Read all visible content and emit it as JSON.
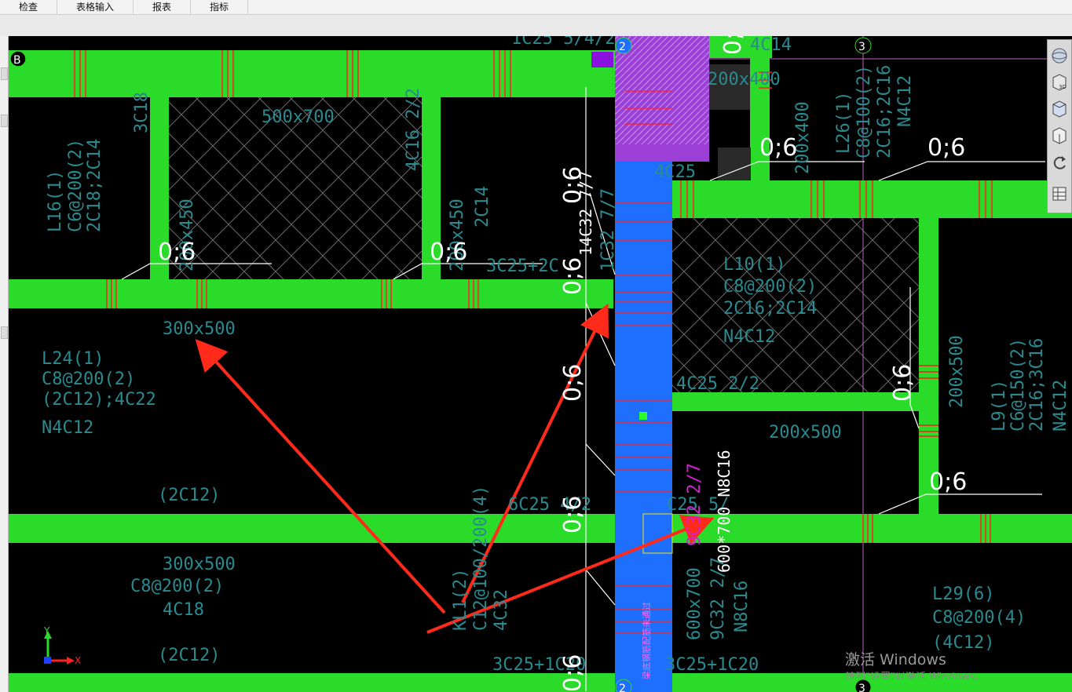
{
  "menu": {
    "items": [
      {
        "label": "检查"
      },
      {
        "label": "表格输入"
      },
      {
        "label": "报表"
      },
      {
        "label": "指标"
      }
    ]
  },
  "axes": {
    "grid_b": "B",
    "grid_2_top": "2",
    "grid_3_top": "3",
    "grid_2_bottom": "2",
    "grid_3_bottom": "3",
    "y_label": "Y",
    "x_label": "X"
  },
  "labels": {
    "sec_500x700": "500x700",
    "tag_4c16": "4C16 2/2",
    "tag_3c18": "3C18",
    "beam_l16": "L16(1)",
    "beam_l16_stirrup": "C6@200(2)",
    "beam_l16_bars": "2C18;2C14",
    "sec_200x450_a": "200x450",
    "sec_200x450_b": "200x450",
    "tag_2c14": "2C14",
    "tag_3c25_2c": "3C25+2C",
    "tag_top_1c25": "1C25 5/4/2",
    "sec_200x400_a": "200x400",
    "sec_200x400_b": "200x400",
    "tag_4c14": "4C14",
    "beam_l26": "L26(1)",
    "beam_l26_stirrup": "C8@100(2)",
    "beam_l26_bars": "2C16;2C16",
    "beam_l26_n": "N4C12",
    "tag_4c25": "4C25",
    "beam_l10": "L10(1)",
    "beam_l10_stirrup": "C8@200(2)",
    "beam_l10_bars": "2C16;2C14",
    "beam_l10_n": "N4C12",
    "tag_4c25_22": "4C25 2/2",
    "sec_200x500_h": "200x500",
    "sec_200x500_v": "200x500",
    "beam_l9": "L9(1)",
    "beam_l9_stirrup": "C6@150(2)",
    "beam_l9_bars": "2C16;3C16",
    "beam_l9_n": "N4C12",
    "sec_300x500_a": "300x500",
    "beam_l24": "L24(1)",
    "beam_l24_stirrup": "C8@200(2)",
    "beam_l24_bars": "(2C12);4C22",
    "beam_l24_n": "N4C12",
    "tag_2c12_a": "(2C12)",
    "tag_6c25_4": "6C25 4/2",
    "tag_c25_5": "C25 5/",
    "sec_300x500_b": "300x500",
    "stirrup_c8_b": "C8@200(2)",
    "tag_4c18": "4C18",
    "tag_2c12_b": "(2C12)",
    "beam_kl1": "KL1(2)",
    "beam_kl1_stirrup": "C12@100/200(4)",
    "beam_kl1_bars": "4C32",
    "tag_3c25_1c20_a": "3C25+1C20",
    "tag_3c25_1c20_b": "3C25+1C20",
    "sec_600x700": "600x700",
    "tag_9c32": "9C32 2/7",
    "tag_n8c16": "N8C16",
    "beam_l29": "L29(6)",
    "beam_l29_stirrup": "C8@200(4)",
    "beam_l29_bars": "(4C12)",
    "tag_14c32_rot": "14C32 7/7",
    "tag_9c32_2_7_mag": "9C32 2/7",
    "tag_600_700_n8c16": "600*700 N8C16",
    "tag_14c32_white": "14C32 7/7",
    "tag_dim_1": "1C32 7/7",
    "beam_note_blue": "梁底钢筋配筋未通过"
  },
  "ratios": {
    "r1": "0;6",
    "r2": "0;6",
    "r3": "0;6",
    "r4": "0;6",
    "r5": "0;6",
    "r6": "0;6",
    "r7": "0;6",
    "r8": "0;6",
    "r9": "0;6",
    "r10": "0;6",
    "r11": "0;6",
    "r12": "0;6",
    "r13": "0;6"
  },
  "watermark": {
    "line1": "激活 Windows",
    "line2": "转到\"设置\"以激活 Windows。"
  },
  "colors": {
    "beam": "#2adb2a",
    "column": "#1f6fff",
    "column_top": "#9b3fd6",
    "rebar": "#ff2020",
    "annotation": "#2a8a8f",
    "magenta": "#d020d0",
    "arrow": "#ff2a1a",
    "grid_line": "#c060c0"
  }
}
